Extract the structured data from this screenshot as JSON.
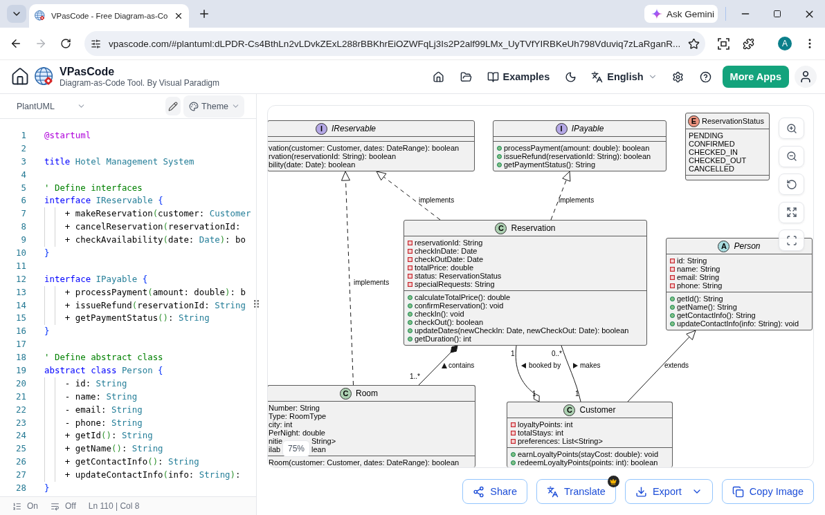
{
  "browser": {
    "tabs": [
      {
        "title": "VPasCode - Free Diagram-as-Co",
        "selected": true
      }
    ],
    "ask_gemini": "Ask Gemini",
    "back_disabled": false,
    "forward_disabled": true,
    "url": "vpascode.com/#plantuml:dLPDR-Cs4BthLn2vLDvkZExL288rBBKhrEiOZWFqLj3Is2P2alf99LMx_UyTVfYIRBKeUh798Vduviq7zLaRganR...",
    "profile_initial": "A"
  },
  "header": {
    "brand": "VPasCode",
    "tagline": "Diagram-as-Code Tool. By Visual Paradigm",
    "nav": [
      {
        "kind": "home"
      },
      {
        "kind": "open"
      },
      {
        "kind": "examples",
        "label": "Examples"
      },
      {
        "kind": "dark_mode"
      },
      {
        "kind": "language",
        "label": "English"
      },
      {
        "kind": "settings"
      },
      {
        "kind": "help"
      }
    ],
    "cta": "More Apps"
  },
  "editor": {
    "language": "PlantUML",
    "theme": "Theme",
    "lines": [
      {
        "number": "1",
        "tokens": [
          {
            "kind": "directive",
            "text": "@startuml"
          }
        ]
      },
      {
        "number": "2"
      },
      {
        "number": "3",
        "tokens": [
          {
            "kind": "keyword",
            "text": "title"
          },
          {
            "kind": "type",
            "text": " Hotel Management System"
          }
        ]
      },
      {
        "number": "4"
      },
      {
        "number": "5",
        "tokens": [
          {
            "kind": "comment",
            "text": "' Define interfaces"
          }
        ]
      },
      {
        "number": "6",
        "tokens": [
          {
            "kind": "keyword",
            "text": "interface"
          },
          {
            "kind": "type",
            "text": " IReservable"
          },
          {
            "kind": "brace",
            "text": " {"
          }
        ],
        "children": [
          {
            "number": "7",
            "tokens": [
              {
                "kind": "plain",
                "text": "+ makeReservation"
              },
              {
                "kind": "paren",
                "text": "("
              },
              {
                "kind": "plain",
                "text": "customer: "
              },
              {
                "kind": "type",
                "text": "Customer"
              }
            ]
          },
          {
            "number": "8",
            "tokens": [
              {
                "kind": "plain",
                "text": "+ cancelReservation"
              },
              {
                "kind": "paren",
                "text": "("
              },
              {
                "kind": "plain",
                "text": "reservationId:"
              }
            ]
          },
          {
            "number": "9",
            "tokens": [
              {
                "kind": "plain",
                "text": "+ checkAvailability"
              },
              {
                "kind": "paren",
                "text": "("
              },
              {
                "kind": "plain",
                "text": "date: "
              },
              {
                "kind": "type",
                "text": "Date"
              },
              {
                "kind": "paren",
                "text": ")"
              },
              {
                "kind": "plain",
                "text": ": bo"
              }
            ]
          }
        ]
      },
      {
        "number": "10",
        "tokens": [
          {
            "kind": "brace",
            "text": "}"
          }
        ]
      },
      {
        "number": "11"
      },
      {
        "number": "12",
        "tokens": [
          {
            "kind": "keyword",
            "text": "interface"
          },
          {
            "kind": "type",
            "text": " IPayable"
          },
          {
            "kind": "brace",
            "text": " {"
          }
        ],
        "children": [
          {
            "number": "13",
            "tokens": [
              {
                "kind": "plain",
                "text": "+ processPayment"
              },
              {
                "kind": "paren",
                "text": "("
              },
              {
                "kind": "plain",
                "text": "amount: double"
              },
              {
                "kind": "paren",
                "text": ")"
              },
              {
                "kind": "plain",
                "text": ": b"
              }
            ]
          },
          {
            "number": "14",
            "tokens": [
              {
                "kind": "plain",
                "text": "+ issueRefund"
              },
              {
                "kind": "paren",
                "text": "("
              },
              {
                "kind": "plain",
                "text": "reservationId: "
              },
              {
                "kind": "type",
                "text": "String"
              }
            ]
          },
          {
            "number": "15",
            "tokens": [
              {
                "kind": "plain",
                "text": "+ getPaymentStatus"
              },
              {
                "kind": "paren",
                "text": "()"
              },
              {
                "kind": "plain",
                "text": ": "
              },
              {
                "kind": "type",
                "text": "String"
              }
            ]
          }
        ]
      },
      {
        "number": "16",
        "tokens": [
          {
            "kind": "brace",
            "text": "}"
          }
        ]
      },
      {
        "number": "17"
      },
      {
        "number": "18",
        "tokens": [
          {
            "kind": "comment",
            "text": "' Define abstract class"
          }
        ]
      },
      {
        "number": "19",
        "tokens": [
          {
            "kind": "keyword",
            "text": "abstract class"
          },
          {
            "kind": "type",
            "text": " Person"
          },
          {
            "kind": "brace",
            "text": " {"
          }
        ],
        "children": [
          {
            "number": "20",
            "tokens": [
              {
                "kind": "plain",
                "text": "- id: "
              },
              {
                "kind": "type",
                "text": "String"
              }
            ]
          },
          {
            "number": "21",
            "tokens": [
              {
                "kind": "plain",
                "text": "- name: "
              },
              {
                "kind": "type",
                "text": "String"
              }
            ]
          },
          {
            "number": "22",
            "tokens": [
              {
                "kind": "plain",
                "text": "- email: "
              },
              {
                "kind": "type",
                "text": "String"
              }
            ]
          },
          {
            "number": "23",
            "tokens": [
              {
                "kind": "plain",
                "text": "- phone: "
              },
              {
                "kind": "type",
                "text": "String"
              }
            ]
          },
          {
            "number": "24",
            "tokens": [
              {
                "kind": "plain",
                "text": "+ getId"
              },
              {
                "kind": "paren",
                "text": "()"
              },
              {
                "kind": "plain",
                "text": ": "
              },
              {
                "kind": "type",
                "text": "String"
              }
            ]
          },
          {
            "number": "25",
            "tokens": [
              {
                "kind": "plain",
                "text": "+ getName"
              },
              {
                "kind": "paren",
                "text": "()"
              },
              {
                "kind": "plain",
                "text": ": "
              },
              {
                "kind": "type",
                "text": "String"
              }
            ]
          },
          {
            "number": "26",
            "tokens": [
              {
                "kind": "plain",
                "text": "+ getContactInfo"
              },
              {
                "kind": "paren",
                "text": "()"
              },
              {
                "kind": "plain",
                "text": ": "
              },
              {
                "kind": "type",
                "text": "String"
              }
            ]
          },
          {
            "number": "27",
            "tokens": [
              {
                "kind": "plain",
                "text": "+ updateContactInfo"
              },
              {
                "kind": "paren",
                "text": "("
              },
              {
                "kind": "plain",
                "text": "info: "
              },
              {
                "kind": "type",
                "text": "String"
              },
              {
                "kind": "paren",
                "text": ")"
              },
              {
                "kind": "plain",
                "text": ":"
              }
            ]
          }
        ]
      },
      {
        "number": "28",
        "tokens": [
          {
            "kind": "brace",
            "text": "}"
          }
        ]
      }
    ],
    "status": {
      "line_numbers": "On",
      "word_wrap": "Off",
      "cursor": "Ln 110 | Col 8"
    }
  },
  "diagram": {
    "classes": [
      {
        "kind": "interface",
        "badge": "I",
        "name": "IReservable",
        "methods": [
          {
            "text": "vation(customer: Customer, dates: DateRange): boolean"
          },
          {
            "text": "rvation(reservationId: String): boolean"
          },
          {
            "text": "bility(date: Date): boolean"
          }
        ]
      },
      {
        "kind": "interface",
        "badge": "I",
        "name": "IPayable",
        "methods": [
          {
            "kind": "public",
            "text": "processPayment(amount: double): boolean"
          },
          {
            "kind": "public",
            "text": "issueRefund(reservationId: String): boolean"
          },
          {
            "kind": "public",
            "text": "getPaymentStatus(): String"
          }
        ]
      },
      {
        "kind": "enum",
        "badge": "E",
        "name": "ReservationStatus",
        "values": [
          "PENDING",
          "CONFIRMED",
          "CHECKED_IN",
          "CHECKED_OUT",
          "CANCELLED"
        ]
      },
      {
        "kind": "class",
        "badge": "C",
        "name": "Reservation",
        "attributes": [
          {
            "kind": "private",
            "text": "reservationId: String"
          },
          {
            "kind": "private",
            "text": "checkInDate: Date"
          },
          {
            "kind": "private",
            "text": "checkOutDate: Date"
          },
          {
            "kind": "private",
            "text": "totalPrice: double"
          },
          {
            "kind": "private",
            "text": "status: ReservationStatus"
          },
          {
            "kind": "private",
            "text": "specialRequests: String"
          }
        ],
        "methods": [
          {
            "kind": "public",
            "text": "calculateTotalPrice(): double"
          },
          {
            "kind": "public",
            "text": "confirmReservation(): void"
          },
          {
            "kind": "public",
            "text": "checkIn(): void"
          },
          {
            "kind": "public",
            "text": "checkOut(): boolean"
          },
          {
            "kind": "public",
            "text": "updateDates(newCheckIn: Date, newCheckOut: Date): boolean"
          },
          {
            "kind": "public",
            "text": "getDuration(): int"
          }
        ]
      },
      {
        "kind": "abstract",
        "badge": "A",
        "name": "Person",
        "attributes": [
          {
            "kind": "private",
            "text": "id: String"
          },
          {
            "kind": "private",
            "text": "name: String"
          },
          {
            "kind": "private",
            "text": "email: String"
          },
          {
            "kind": "private",
            "text": "phone: String"
          }
        ],
        "methods": [
          {
            "kind": "public",
            "text": "getId(): String"
          },
          {
            "kind": "public",
            "text": "getName(): String"
          },
          {
            "kind": "public",
            "text": "getContactInfo(): String"
          },
          {
            "kind": "public",
            "text": "updateContactInfo(info: String): void"
          }
        ]
      },
      {
        "kind": "class",
        "badge": "C",
        "name": "Room",
        "attributes": [
          {
            "text": "Number: String"
          },
          {
            "text": "Type: RoomType"
          },
          {
            "text": "city: int"
          },
          {
            "text": "PerNight: double"
          },
          {
            "segments": [
              "nitie",
              "String>"
            ]
          },
          {
            "segments": [
              "ilab",
              "lean"
            ]
          }
        ],
        "methods": [
          {
            "text": "Room(customer: Customer, dates: DateRange): boolean"
          }
        ]
      },
      {
        "kind": "class",
        "badge": "C",
        "name": "Customer",
        "attributes": [
          {
            "kind": "private",
            "text": "loyaltyPoints: int"
          },
          {
            "kind": "private",
            "text": "totalStays: int"
          },
          {
            "kind": "private",
            "text": "preferences: List<String>"
          }
        ],
        "methods": [
          {
            "kind": "public",
            "text": "earnLoyaltyPoints(stayCost: double): void"
          },
          {
            "kind": "public",
            "text": "redeemLoyaltyPoints(points: int): boolean"
          }
        ]
      }
    ],
    "relations": [
      {
        "kind": "realization",
        "label": {
          "text": "implements"
        }
      },
      {
        "kind": "realization",
        "label": {
          "text": "implements"
        }
      },
      {
        "kind": "realization",
        "label": {
          "text": "implements"
        }
      },
      {
        "kind": "composition",
        "label": {
          "kind": "up",
          "text": "contains"
        },
        "multiplicities": [
          "1..*"
        ]
      },
      {
        "kind": "aggregation",
        "label": {
          "kind": "left",
          "text": "booked by"
        },
        "multiplicities": [
          "1",
          "1"
        ]
      },
      {
        "kind": "association",
        "label": {
          "kind": "right",
          "text": "makes"
        },
        "multiplicities": [
          "0..*",
          "1"
        ]
      },
      {
        "kind": "generalization",
        "label": {
          "text": "extends"
        }
      }
    ],
    "zoom_level": "75%"
  },
  "actions": [
    {
      "kind": "share",
      "label": "Share"
    },
    {
      "kind": "translate",
      "label": "Translate",
      "premium": true
    },
    {
      "kind": "export",
      "label": "Export",
      "menu": true
    },
    {
      "kind": "copy",
      "label": "Copy Image"
    }
  ]
}
